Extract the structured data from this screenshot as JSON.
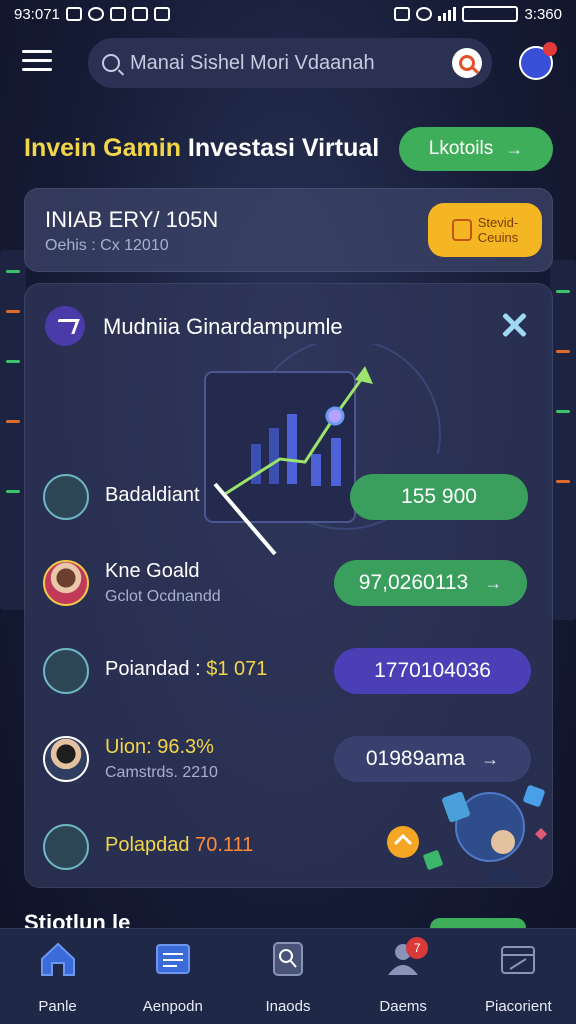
{
  "status_bar": {
    "time": "93:071",
    "clock_right": "3:360"
  },
  "app_bar": {
    "search_placeholder": "Manai Sishel Mori Vdaanah"
  },
  "title_row": {
    "title_highlight": "Invein Gamin",
    "title_rest": " Investasi Virtual",
    "details_label": "Lkotoils"
  },
  "balance_card": {
    "title": "INIAB ERY/ 105N",
    "subtitle": "Oehis : Cx 12010",
    "badge_line1": "Stevid-",
    "badge_line2": "Ceuins"
  },
  "panel": {
    "title": "Mudniia Ginardampumle",
    "rows": [
      {
        "label": "Badaldiant",
        "value": "155 900"
      },
      {
        "label": "Kne Goald",
        "sub": "Gclot Ocdnandd",
        "value": "97,0260113"
      },
      {
        "label": "Poiandad :",
        "label_accent": "$1 071",
        "value": "1770104036"
      },
      {
        "label_accent": "Uion: 96.3%",
        "sub": "Camstrds. 2210",
        "value": "01989ama"
      },
      {
        "label_accent": "Polapdad",
        "label_accent2": "70.111"
      }
    ]
  },
  "peek": {
    "title": "Stiotlun le"
  },
  "bottom_nav": [
    {
      "label": "Panle",
      "icon": "home-icon"
    },
    {
      "label": "Aenpodn",
      "icon": "portfolio-icon"
    },
    {
      "label": "Inaods",
      "icon": "search-doc-icon"
    },
    {
      "label": "Daems",
      "icon": "user-icon",
      "badge": "7"
    },
    {
      "label": "Piacorient",
      "icon": "briefcase-icon"
    }
  ],
  "colors": {
    "background": "#161c36",
    "green": "#3fae5a",
    "purple": "#4a3fb4",
    "gold": "#f5b623",
    "highlight": "#f2d64a"
  }
}
